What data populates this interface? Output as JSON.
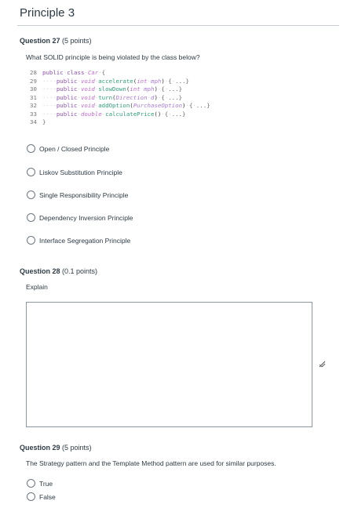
{
  "page": {
    "title": "Principle 3"
  },
  "q27": {
    "number_label": "Question 27",
    "points": "(5 points)",
    "prompt": "What SOLID principle is being violated  by the class below?",
    "code": [
      {
        "ln": "28",
        "parts": [
          [
            "kw",
            "public"
          ],
          [
            "dots",
            "·"
          ],
          [
            "kw",
            "class"
          ],
          [
            "dots",
            "·"
          ],
          [
            "ty",
            "Car"
          ],
          [
            "dots",
            "·"
          ],
          [
            "brace",
            "{"
          ]
        ]
      },
      {
        "ln": "29",
        "parts": [
          [
            "dots",
            "····"
          ],
          [
            "kw",
            "public"
          ],
          [
            "dots",
            "·"
          ],
          [
            "ty",
            "void"
          ],
          [
            "dots",
            "·"
          ],
          [
            "fn",
            "accelerate"
          ],
          [
            "pu",
            "("
          ],
          [
            "ty",
            "int"
          ],
          [
            "dots",
            "·"
          ],
          [
            "pm",
            "mph"
          ],
          [
            "pu",
            ")"
          ],
          [
            "dots",
            "·"
          ],
          [
            "brace",
            "{"
          ],
          [
            "dots",
            "·"
          ],
          [
            "brace",
            "...}"
          ]
        ]
      },
      {
        "ln": "30",
        "parts": [
          [
            "dots",
            "····"
          ],
          [
            "kw",
            "public"
          ],
          [
            "dots",
            "·"
          ],
          [
            "ty",
            "void"
          ],
          [
            "dots",
            "·"
          ],
          [
            "fn",
            "slowDown"
          ],
          [
            "pu",
            "("
          ],
          [
            "ty",
            "int"
          ],
          [
            "dots",
            "·"
          ],
          [
            "pm",
            "mph"
          ],
          [
            "pu",
            ")"
          ],
          [
            "dots",
            "·"
          ],
          [
            "brace",
            "{"
          ],
          [
            "dots",
            "·"
          ],
          [
            "brace",
            "...}"
          ]
        ]
      },
      {
        "ln": "31",
        "parts": [
          [
            "dots",
            "····"
          ],
          [
            "kw",
            "public"
          ],
          [
            "dots",
            "·"
          ],
          [
            "ty",
            "void"
          ],
          [
            "dots",
            "·"
          ],
          [
            "fn",
            "turn"
          ],
          [
            "pu",
            "("
          ],
          [
            "pm",
            "Direction"
          ],
          [
            "dots",
            "·"
          ],
          [
            "pm",
            "d"
          ],
          [
            "pu",
            ")"
          ],
          [
            "dots",
            "·"
          ],
          [
            "brace",
            "{"
          ],
          [
            "dots",
            "·"
          ],
          [
            "brace",
            "...}"
          ]
        ]
      },
      {
        "ln": "32",
        "parts": [
          [
            "dots",
            "····"
          ],
          [
            "kw",
            "public"
          ],
          [
            "dots",
            "·"
          ],
          [
            "ty",
            "void"
          ],
          [
            "dots",
            "·"
          ],
          [
            "fn",
            "addOption"
          ],
          [
            "pu",
            "("
          ],
          [
            "pm",
            "PurchaseOption"
          ],
          [
            "pu",
            ")"
          ],
          [
            "dots",
            "·"
          ],
          [
            "brace",
            "{"
          ],
          [
            "dots",
            "·"
          ],
          [
            "brace",
            "...}"
          ]
        ]
      },
      {
        "ln": "33",
        "parts": [
          [
            "dots",
            "····"
          ],
          [
            "kw",
            "public"
          ],
          [
            "dots",
            "·"
          ],
          [
            "ty",
            "double"
          ],
          [
            "dots",
            "·"
          ],
          [
            "fn",
            "calculatePrice"
          ],
          [
            "pu",
            "()"
          ],
          [
            "dots",
            "·"
          ],
          [
            "brace",
            "{"
          ],
          [
            "dots",
            "·"
          ],
          [
            "brace",
            "...}"
          ]
        ]
      },
      {
        "ln": "34",
        "parts": [
          [
            "brace",
            "}"
          ]
        ]
      }
    ],
    "options": [
      "Open / Closed Principle",
      "Liskov Substitution Principle",
      "Single Responsibility Principle",
      "Dependency Inversion Principle",
      "Interface Segregation Principle"
    ]
  },
  "q28": {
    "number_label": "Question 28",
    "points": "(0.1 points)",
    "prompt": "Explain",
    "answer_value": ""
  },
  "q29": {
    "number_label": "Question 29",
    "points": "(5 points)",
    "prompt": "The Strategy pattern and the Template Method pattern are used for similar purposes.",
    "options": [
      "True",
      "False"
    ]
  }
}
